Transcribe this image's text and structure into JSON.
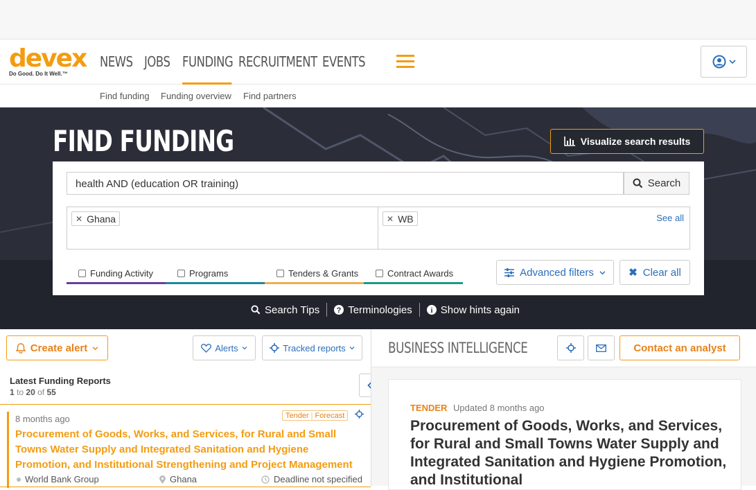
{
  "brand": {
    "logo": "devex",
    "tagline": "Do Good. Do It Well.™",
    "accent": "#f39c12",
    "link": "#2a6ebb"
  },
  "nav": {
    "items": [
      "NEWS",
      "JOBS",
      "FUNDING",
      "RECRUITMENT",
      "EVENTS"
    ],
    "active": "FUNDING"
  },
  "subnav": [
    "Find funding",
    "Funding overview",
    "Find partners"
  ],
  "hero": {
    "title": "FIND FUNDING",
    "visualize_label": "Visualize search results",
    "search": {
      "value": "health AND (education OR training)",
      "button": "Search"
    },
    "filters": {
      "location_chip": "Ghana",
      "donor_chip": "WB",
      "see_all": "See all"
    },
    "tabs": [
      "Funding Activity",
      "Programs",
      "Tenders & Grants",
      "Contract Awards"
    ],
    "tab_colors": [
      "#6a3d9a",
      "#1b8a9a",
      "#f0ad4e",
      "#1b9a8a"
    ],
    "advanced_filters": "Advanced filters",
    "clear_all": "Clear all",
    "hints": [
      "Search Tips",
      "Terminologies",
      "Show hints again"
    ]
  },
  "left": {
    "create_alert": "Create alert",
    "alerts": "Alerts",
    "tracked_reports": "Tracked reports",
    "list_title": "Latest Funding Reports",
    "count": {
      "from": "1",
      "to_word": "to",
      "to": "20",
      "of_word": "of",
      "total": "55"
    },
    "card": {
      "time": "8 months ago",
      "badge_type": "Tender",
      "badge_stage": "Forecast",
      "title": "Procurement of Goods, Works, and Services, for Rural and Small Towns Water Supply and Integrated Sanitation and Hygiene Promotion, and Institutional Strengthening and Project Management",
      "donor": "World Bank Group",
      "location": "Ghana",
      "deadline": "Deadline not specified"
    }
  },
  "right": {
    "heading": "BUSINESS INTELLIGENCE",
    "contact": "Contact an analyst",
    "detail": {
      "kind": "TENDER",
      "updated": "Updated 8 months ago",
      "title": "Procurement of Goods, Works, and Services, for Rural and Small Towns Water Supply and Integrated Sanitation and Hygiene Promotion, and Institutional"
    }
  }
}
